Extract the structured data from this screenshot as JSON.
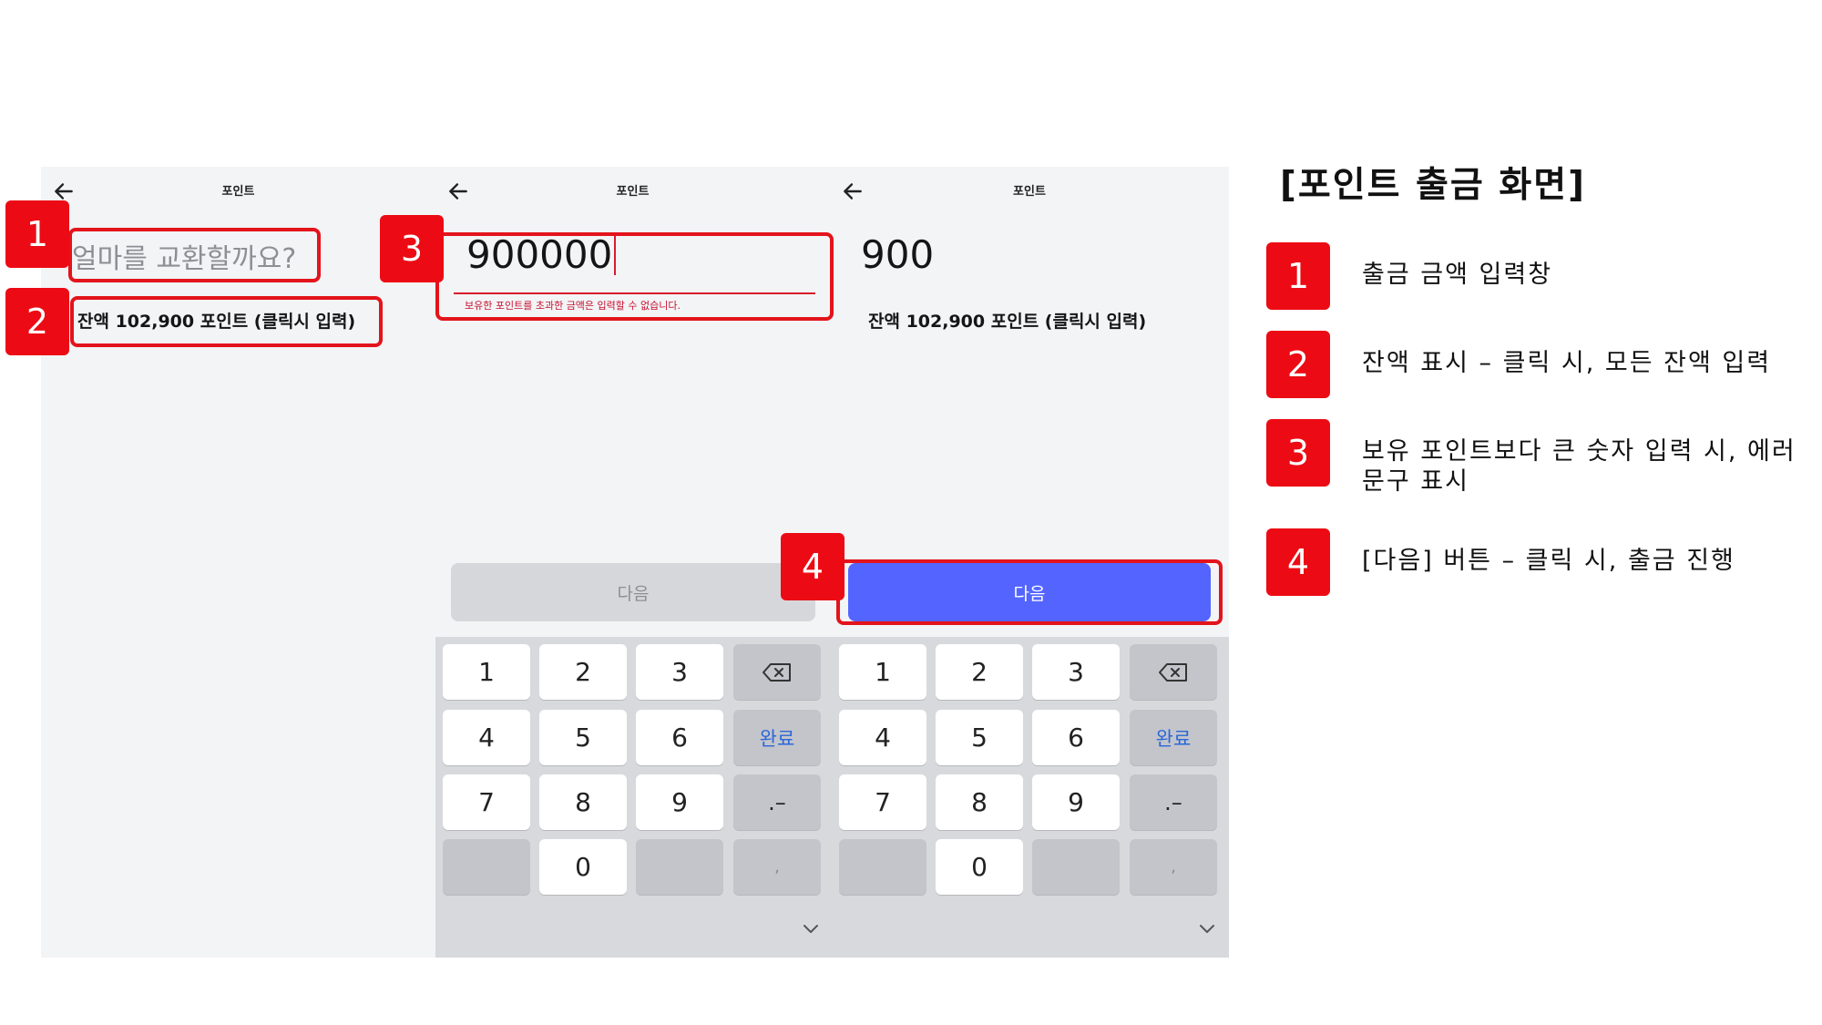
{
  "screens": {
    "common": {
      "title": "포인트"
    },
    "screen1": {
      "placeholder": "얼마를 교환할까요?",
      "balance": "잔액 102,900 포인트 (클릭시 입력)"
    },
    "screen2": {
      "amount": "900000",
      "error": "보유한 포인트를 초과한 금액은 입력할 수 없습니다.",
      "next_label": "다음"
    },
    "screen3": {
      "amount": "900",
      "balance": "잔액 102,900 포인트 (클릭시 입력)",
      "next_label": "다음"
    }
  },
  "keyboard": {
    "keys": [
      "1",
      "2",
      "3",
      "4",
      "5",
      "6",
      "7",
      "8",
      "9",
      "0"
    ],
    "done_label": "완료",
    "punct_label": ".–",
    "comma_label": ","
  },
  "badges": [
    "1",
    "2",
    "3",
    "4"
  ],
  "panel": {
    "title": "[포인트 출금 화면]",
    "items": [
      {
        "num": "1",
        "text": "출금 금액 입력창"
      },
      {
        "num": "2",
        "text": "잔액 표시 – 클릭 시, 모든 잔액 입력"
      },
      {
        "num": "3",
        "text": "보유 포인트보다 큰 숫자 입력 시, 에러 문구 표시"
      },
      {
        "num": "4",
        "text": "[다음] 버튼 – 클릭 시, 출금 진행"
      }
    ]
  },
  "colors": {
    "accent_button": "#5465ff",
    "callout_red": "#e3141b",
    "badge_red": "#ec0b14",
    "error_red": "#c8102e",
    "screen_bg": "#f3f4f6",
    "keyboard_bg": "#d8d9dd"
  },
  "icons": [
    "back-arrow-icon",
    "backspace-icon",
    "chevron-down-icon"
  ]
}
